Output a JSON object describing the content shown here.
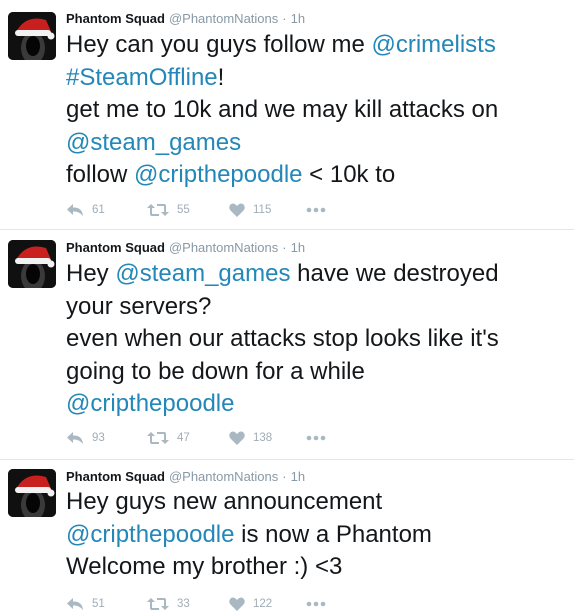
{
  "colors": {
    "link": "#2387b8",
    "muted": "#8899a6",
    "divider": "#e1e8ed",
    "icon": "#aab8c2"
  },
  "tweets": [
    {
      "name": "Phantom Squad",
      "handle": "@PhantomNations",
      "separator": "·",
      "time": "1h",
      "lines": [
        [
          "Hey can you guys follow me ",
          "@crimelists"
        ],
        [
          "#SteamOffline",
          "!"
        ],
        [
          "get me to 10k and we may kill attacks on"
        ],
        [
          "@steam_games"
        ],
        [
          "follow ",
          "@cripthepoodle",
          " < 10k to"
        ]
      ],
      "replies": "61",
      "retweets": "55",
      "likes": "115"
    },
    {
      "name": "Phantom Squad",
      "handle": "@PhantomNations",
      "separator": "·",
      "time": "1h",
      "lines": [
        [
          "Hey ",
          "@steam_games",
          " have we destroyed"
        ],
        [
          "your servers?"
        ],
        [
          "even when our attacks stop looks like it's"
        ],
        [
          "going to be down for a while"
        ],
        [
          "@cripthepoodle"
        ]
      ],
      "replies": "93",
      "retweets": "47",
      "likes": "138"
    },
    {
      "name": "Phantom Squad",
      "handle": "@PhantomNations",
      "separator": "·",
      "time": "1h",
      "lines": [
        [
          "Hey guys new announcement"
        ],
        [
          "@cripthepoodle",
          " is now a Phantom"
        ],
        [
          "Welcome my brother :) <3"
        ]
      ],
      "replies": "51",
      "retweets": "33",
      "likes": "122"
    }
  ]
}
